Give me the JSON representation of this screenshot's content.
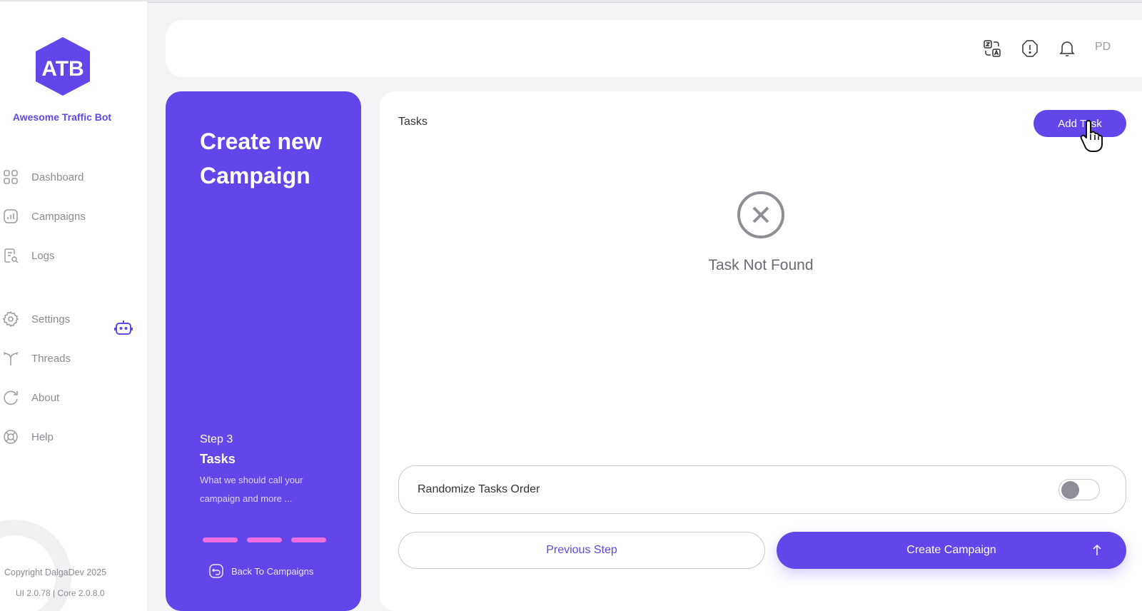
{
  "app": {
    "brand_name": "Awesome Traffic Bot",
    "accent_color": "#6246ea",
    "pill_color": "#ee6ee0"
  },
  "sidebar": {
    "items": [
      {
        "label": "Dashboard",
        "icon": "grid-icon"
      },
      {
        "label": "Campaigns",
        "icon": "chart-icon"
      },
      {
        "label": "Logs",
        "icon": "document-search-icon"
      },
      {
        "label": "Settings",
        "icon": "gear-icon"
      },
      {
        "label": "Threads",
        "icon": "fork-icon"
      },
      {
        "label": "About",
        "icon": "circular-arrow-icon"
      },
      {
        "label": "Help",
        "icon": "lifebuoy-icon"
      }
    ],
    "copyright": "Copyright DalgaDev 2025",
    "version": "UI 2.0.78 | Core 2.0.8.0"
  },
  "header": {
    "icons": [
      "translate-icon",
      "alert-octagon-icon",
      "bell-icon"
    ],
    "avatar_initials": "PD"
  },
  "wizard": {
    "title": "Create new Campaign",
    "step_number": "Step 3",
    "step_name": "Tasks",
    "step_description": "What we should call your campaign and more ...",
    "progress_steps": 3,
    "back_label": "Back To Campaigns"
  },
  "tasks": {
    "heading": "Tasks",
    "add_button": "Add Task",
    "empty_message": "Task Not Found",
    "randomize_label": "Randomize Tasks Order",
    "randomize_enabled": false,
    "previous_button": "Previous Step",
    "create_button": "Create Campaign"
  }
}
